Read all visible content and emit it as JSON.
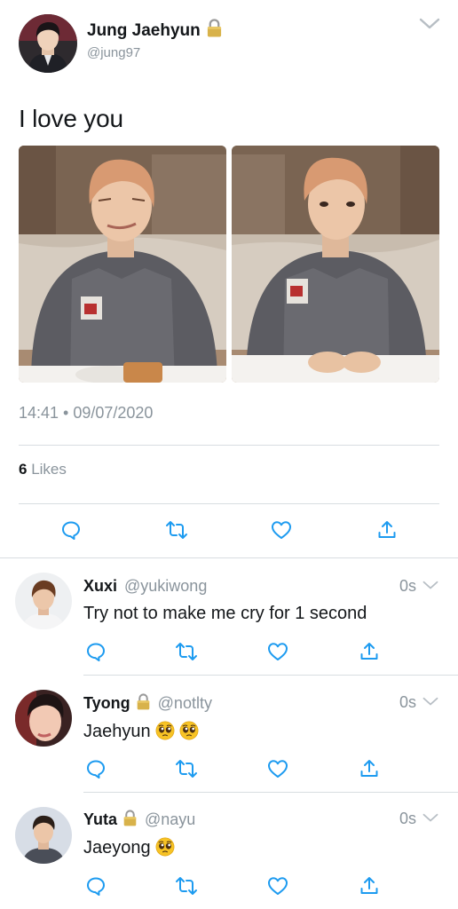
{
  "tweet": {
    "author_name": "Jung Jaehyun",
    "author_handle": "@jung97",
    "text": "I love you",
    "timestamp": "14:41 • 09/07/2020",
    "likes_count": "6",
    "likes_label": " Likes",
    "icons": [
      "lock-icon",
      "chevron-down-icon",
      "reply-icon",
      "retweet-icon",
      "like-icon",
      "share-icon"
    ]
  },
  "replies": [
    {
      "name": "Xuxi",
      "handle": "@yukiwong",
      "time": "0s",
      "text": "Try not to make me cry for 1 second",
      "locked": false
    },
    {
      "name": "Tyong",
      "handle": "@notlty",
      "time": "0s",
      "text": "Jaehyun",
      "locked": true,
      "emoji": [
        "pleading-face-emoji",
        "pleading-face-emoji"
      ]
    },
    {
      "name": "Yuta",
      "handle": "@nayu",
      "time": "0s",
      "text": "Jaeyong",
      "locked": true,
      "emoji": [
        "pleading-face-emoji"
      ]
    }
  ],
  "colors": {
    "text": "#14171a",
    "secondary": "#8a949c",
    "divider": "#d8dde1",
    "icon": "#1da1f2"
  }
}
